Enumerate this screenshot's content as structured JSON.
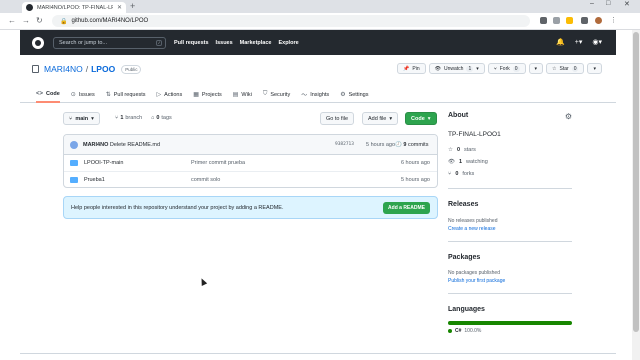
{
  "browser": {
    "tab_title": "MARI4NO/LPOO: TP-FINAL-LPO",
    "url": "github.com/MARI4NO/LPOO"
  },
  "gh_header": {
    "search_placeholder": "Search or jump to...",
    "search_key": "/",
    "nav": [
      "Pull requests",
      "Issues",
      "Marketplace",
      "Explore"
    ]
  },
  "repo": {
    "owner": "MARI4NO",
    "separator": "/",
    "name": "LPOO",
    "visibility": "Public",
    "actions": {
      "pin": "Pin",
      "watch": "Unwatch",
      "watch_count": "1",
      "fork": "Fork",
      "fork_count": "0",
      "star": "Star",
      "star_count": "0"
    },
    "tabs": [
      {
        "label": "Code",
        "icon": "code-icon"
      },
      {
        "label": "Issues",
        "icon": "issue-icon"
      },
      {
        "label": "Pull requests",
        "icon": "pull-request-icon"
      },
      {
        "label": "Actions",
        "icon": "play-icon"
      },
      {
        "label": "Projects",
        "icon": "table-icon"
      },
      {
        "label": "Wiki",
        "icon": "book-icon"
      },
      {
        "label": "Security",
        "icon": "shield-icon"
      },
      {
        "label": "Insights",
        "icon": "graph-icon"
      },
      {
        "label": "Settings",
        "icon": "gear-icon"
      }
    ]
  },
  "code": {
    "branch": "main",
    "branches": "1",
    "branches_label": "branch",
    "tags": "0",
    "tags_label": "tags",
    "goto_file": "Go to file",
    "add_file": "Add file",
    "code_btn": "Code",
    "commit": {
      "author": "MARI4NO",
      "message": "Delete README.md",
      "sha": "9382713",
      "age": "5 hours ago",
      "commits_count": "9",
      "commits_label": "commits"
    },
    "files": [
      {
        "name": "LPOOI-TP-main",
        "message": "Primer commit prueba",
        "age": "6 hours ago"
      },
      {
        "name": "Prueba1",
        "message": "commit solo",
        "age": "5 hours ago"
      }
    ],
    "readme_hint": "Help people interested in this repository understand your project by adding a README.",
    "add_readme": "Add a README"
  },
  "sidebar": {
    "about_title": "About",
    "description": "TP-FINAL-LPOO1",
    "stars": "0",
    "stars_label": "stars",
    "watching": "1",
    "watching_label": "watching",
    "forks": "0",
    "forks_label": "forks",
    "releases_title": "Releases",
    "releases_empty": "No releases published",
    "releases_link": "Create a new release",
    "packages_title": "Packages",
    "packages_empty": "No packages published",
    "packages_link": "Publish your first package",
    "languages_title": "Languages",
    "language": "C#",
    "language_pct": "100.0%",
    "language_color": "#178600"
  },
  "colors": {
    "header_bg": "#24292f",
    "accent_green": "#2da44e",
    "link_blue": "#0969da",
    "tab_underline": "#fd8c73"
  }
}
